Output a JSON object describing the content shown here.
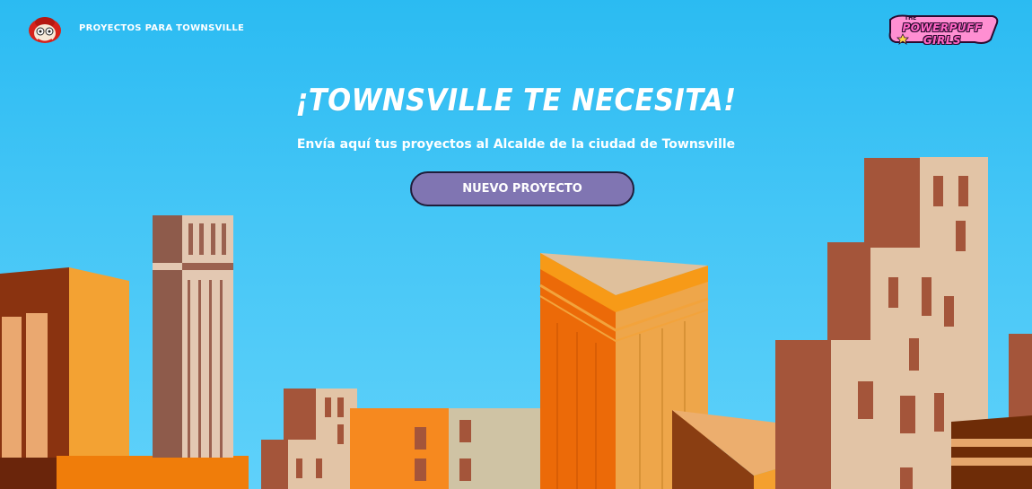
{
  "header": {
    "logo_icon": "mayor-face-icon",
    "nav_title": "PROYECTOS PARA TOWNSVILLE",
    "brand_logo": {
      "icon": "powerpuff-girls-logo",
      "the_text": "THE",
      "wordmark": "POWERPUFF GIRLS"
    }
  },
  "hero": {
    "title": "¡TOWNSVILLE TE NECESITA!",
    "subtitle": "Envía aquí tus proyectos al Alcalde de la ciudad de Townsville",
    "cta_label": "NUEVO PROYECTO"
  },
  "colors": {
    "sky_top": "#2bbbf2",
    "sky_bottom": "#5fd1fa",
    "button_fill": "#8075b2",
    "button_border": "#1f1d3a",
    "brown": "#a1573e",
    "tan": "#e2c4a6",
    "orange": "#f6891f"
  },
  "background": {
    "illustration": "townsville-city-skyline"
  }
}
